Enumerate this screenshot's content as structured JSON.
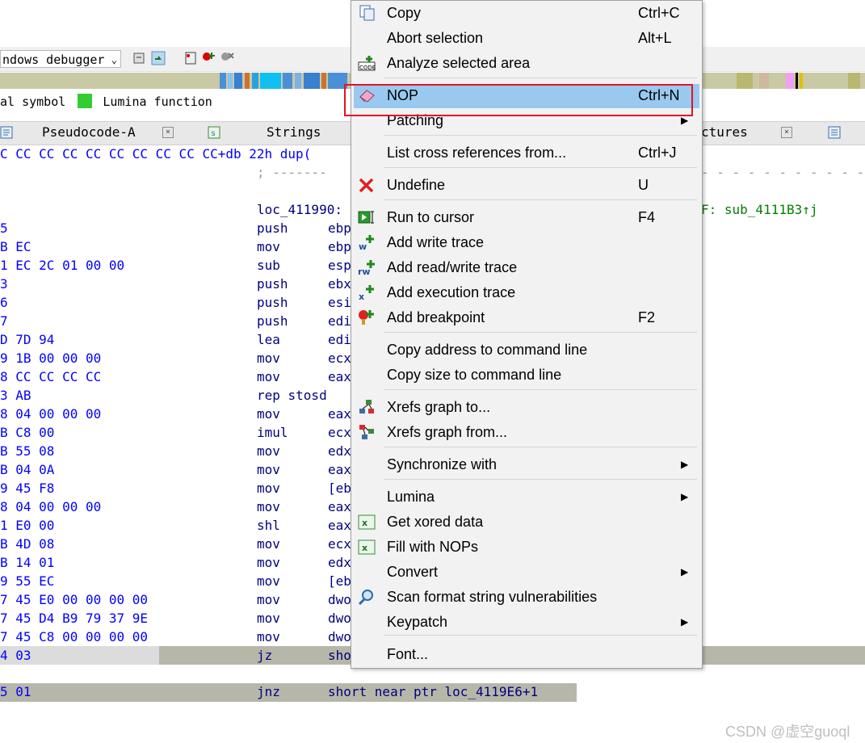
{
  "toolbar": {
    "debugger": "ndows debugger"
  },
  "legend": {
    "text1": "al symbol",
    "text2": "Lumina function",
    "lumina_color": "#33cc33"
  },
  "tabs": [
    {
      "label": "Pseudocode-A"
    },
    {
      "label": "Strings"
    },
    {
      "label": "ctures"
    }
  ],
  "disasm": {
    "top_line": "C CC CC CC CC CC CC CC CC CC+db 22h dup(",
    "dashed": "; -------",
    "loc_label": "loc_411990:",
    "xref_comment": "F: sub_4111B3↑j",
    "rows": [
      {
        "hex": "5",
        "mn": "push",
        "op": "ebp"
      },
      {
        "hex": "B EC",
        "mn": "mov",
        "op": "ebp"
      },
      {
        "hex": "1 EC 2C 01 00 00",
        "mn": "sub",
        "op": "esp"
      },
      {
        "hex": "3",
        "mn": "push",
        "op": "ebx"
      },
      {
        "hex": "6",
        "mn": "push",
        "op": "esi"
      },
      {
        "hex": "7",
        "mn": "push",
        "op": "edi"
      },
      {
        "hex": "D 7D 94",
        "mn": "lea",
        "op": "edi"
      },
      {
        "hex": "9 1B 00 00 00",
        "mn": "mov",
        "op": "ecx"
      },
      {
        "hex": "8 CC CC CC CC",
        "mn": "mov",
        "op": "eax"
      },
      {
        "hex": "3 AB",
        "mn": "rep stosd",
        "op": ""
      },
      {
        "hex": "8 04 00 00 00",
        "mn": "mov",
        "op": "eax"
      },
      {
        "hex": "B C8 00",
        "mn": "imul",
        "op": "ecx"
      },
      {
        "hex": "B 55 08",
        "mn": "mov",
        "op": "edx"
      },
      {
        "hex": "B 04 0A",
        "mn": "mov",
        "op": "eax"
      },
      {
        "hex": "9 45 F8",
        "mn": "mov",
        "op": "[eb"
      },
      {
        "hex": "8 04 00 00 00",
        "mn": "mov",
        "op": "eax"
      },
      {
        "hex": "1 E0 00",
        "mn": "shl",
        "op": "eax"
      },
      {
        "hex": "B 4D 08",
        "mn": "mov",
        "op": "ecx"
      },
      {
        "hex": "B 14 01",
        "mn": "mov",
        "op": "edx"
      },
      {
        "hex": "9 55 EC",
        "mn": "mov",
        "op": "[eb"
      },
      {
        "hex": "7 45 E0 00 00 00 00",
        "mn": "mov",
        "op": "dwo"
      },
      {
        "hex": "7 45 D4 B9 79 37 9E",
        "mn": "mov",
        "op": "dwo"
      },
      {
        "hex": "7 45 C8 00 00 00 00",
        "mn": "mov",
        "op": "dwo"
      },
      {
        "hex": "4 03",
        "mn": "jz",
        "op": "sho"
      }
    ],
    "jnz_row": {
      "hex": "5 01",
      "mn": "jnz",
      "op": "short near ptr loc_4119E6+1"
    }
  },
  "menu": {
    "items": [
      {
        "label": "Copy",
        "shortcut": "Ctrl+C",
        "icon": "copy-icon"
      },
      {
        "label": "Abort selection",
        "shortcut": "Alt+L",
        "icon": ""
      },
      {
        "label": "Analyze selected area",
        "shortcut": "",
        "icon": "analyze-code-icon"
      },
      {
        "label": "NOP",
        "shortcut": "Ctrl+N",
        "icon": "eraser-icon"
      },
      {
        "label": "Patching",
        "shortcut": "",
        "icon": ""
      },
      {
        "label": "List cross references from...",
        "shortcut": "Ctrl+J",
        "icon": ""
      },
      {
        "label": "Undefine",
        "shortcut": "U",
        "icon": "red-x-icon"
      },
      {
        "label": "Run to cursor",
        "shortcut": "F4",
        "icon": "run-to-cursor-icon"
      },
      {
        "label": "Add write trace",
        "shortcut": "",
        "icon": "write-trace-icon"
      },
      {
        "label": "Add read/write trace",
        "shortcut": "",
        "icon": "read-write-trace-icon"
      },
      {
        "label": "Add execution trace",
        "shortcut": "",
        "icon": "execution-trace-icon"
      },
      {
        "label": "Add breakpoint",
        "shortcut": "F2",
        "icon": "breakpoint-icon"
      },
      {
        "label": "Copy address to command line",
        "shortcut": "",
        "icon": ""
      },
      {
        "label": "Copy size to command line",
        "shortcut": "",
        "icon": ""
      },
      {
        "label": "Xrefs graph to...",
        "shortcut": "",
        "icon": "xrefs-graph-to-icon"
      },
      {
        "label": "Xrefs graph from...",
        "shortcut": "",
        "icon": "xrefs-graph-from-icon"
      },
      {
        "label": "Synchronize with",
        "shortcut": "",
        "icon": ""
      },
      {
        "label": "Lumina",
        "shortcut": "",
        "icon": ""
      },
      {
        "label": "Get xored data",
        "shortcut": "",
        "icon": "plugin-script-icon"
      },
      {
        "label": "Fill with NOPs",
        "shortcut": "",
        "icon": "plugin-script-icon"
      },
      {
        "label": "Convert",
        "shortcut": "",
        "icon": ""
      },
      {
        "label": "Scan format string vulnerabilities",
        "shortcut": "",
        "icon": "magnifier-icon"
      },
      {
        "label": "Keypatch",
        "shortcut": "",
        "icon": ""
      },
      {
        "label": "Font...",
        "shortcut": "",
        "icon": ""
      }
    ]
  },
  "watermark": "CSDN @虚空guoql"
}
